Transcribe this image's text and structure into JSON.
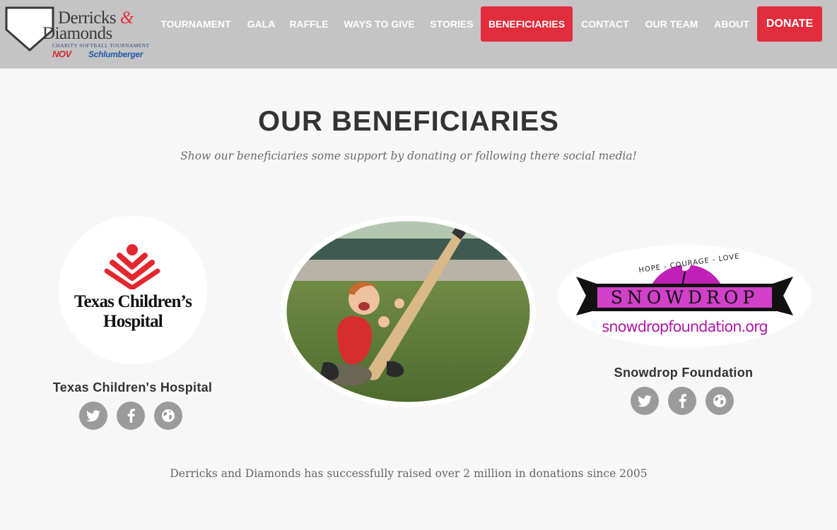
{
  "brand": {
    "line1": "Derricks",
    "amp": "&",
    "line2": "Diamonds",
    "tagline": "CHARITY SOFTBALL TOURNAMENT",
    "sponsor1": "NOV",
    "sponsor2": "Schlumberger"
  },
  "nav": {
    "items": [
      "TOURNAMENT",
      "GALA",
      "RAFFLE",
      "WAYS TO GIVE",
      "STORIES",
      "BENEFICIARIES",
      "CONTACT",
      "OUR TEAM",
      "ABOUT"
    ],
    "active": "BENEFICIARIES",
    "donate": "DONATE"
  },
  "page": {
    "title": "OUR BENEFICIARIES",
    "subtitle": "Show our beneficiaries some support by donating or following there social media!",
    "footer": "Derricks and Diamonds has successfully raised over 2 million in donations since 2005"
  },
  "beneficiaries": [
    {
      "name": "Texas Children's Hospital",
      "logo_text": [
        "Texas Children’s",
        "Hospital"
      ],
      "social": [
        "twitter-icon",
        "facebook-icon",
        "globe-icon"
      ]
    },
    {
      "name": "Snowdrop Foundation",
      "logo_text": {
        "arc": "HOPE - COURAGE - LOVE",
        "banner": "SNOWDROP",
        "url": "snowdropfoundation.org"
      },
      "social": [
        "twitter-icon",
        "facebook-icon",
        "globe-icon"
      ]
    }
  ],
  "colors": {
    "header_bg": "#c4c4c4",
    "accent": "#e22d3d",
    "page_bg": "#f7f7f7",
    "social_bg": "#9b9b9b",
    "snowdrop_magenta": "#c020b8"
  }
}
